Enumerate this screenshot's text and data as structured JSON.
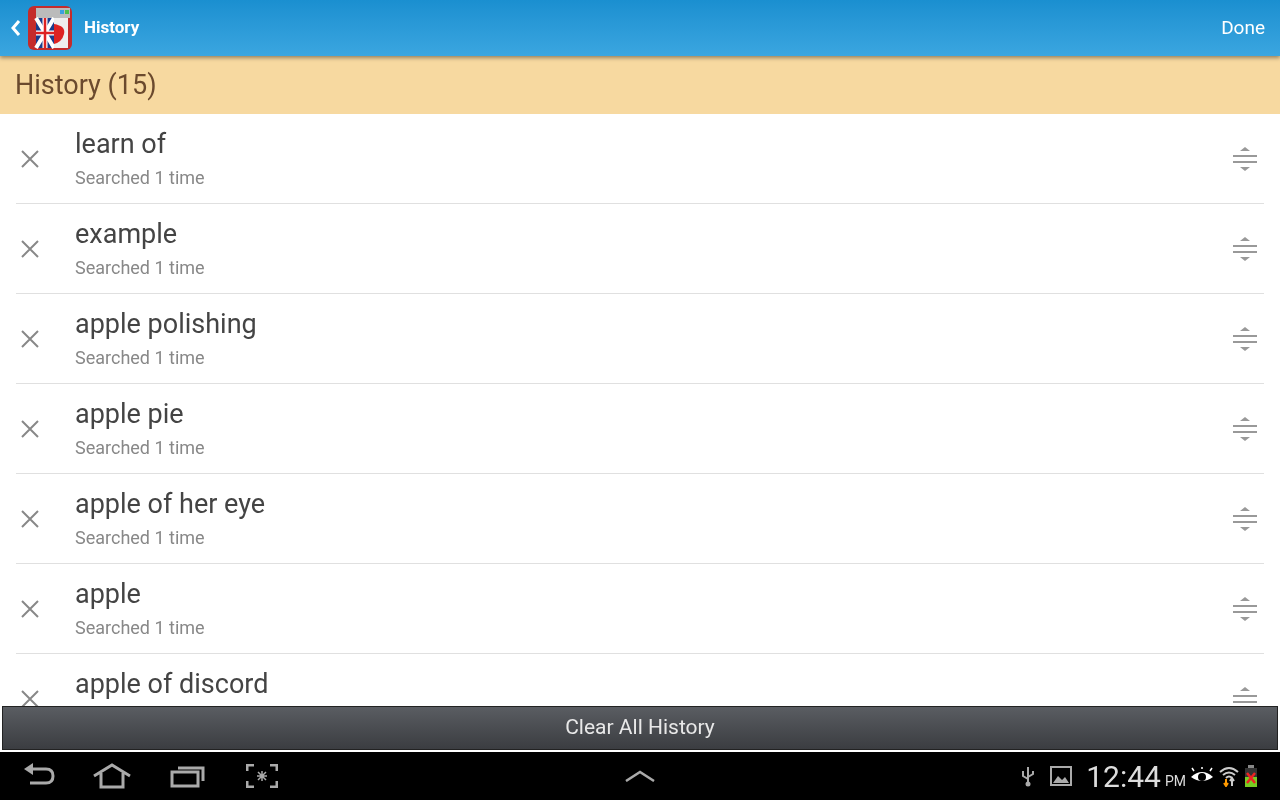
{
  "action_bar": {
    "title": "History",
    "done": "Done"
  },
  "section": {
    "title": "History (15)"
  },
  "items": [
    {
      "term": "learn of",
      "detail": "Searched 1 time"
    },
    {
      "term": "example",
      "detail": "Searched 1 time"
    },
    {
      "term": "apple polishing",
      "detail": "Searched 1 time"
    },
    {
      "term": "apple pie",
      "detail": "Searched 1 time"
    },
    {
      "term": "apple of her eye",
      "detail": "Searched 1 time"
    },
    {
      "term": "apple",
      "detail": "Searched 1 time"
    },
    {
      "term": "apple of discord"
    }
  ],
  "clear_button": "Clear All History",
  "status_bar": {
    "time": "12:44",
    "ampm": "PM"
  }
}
